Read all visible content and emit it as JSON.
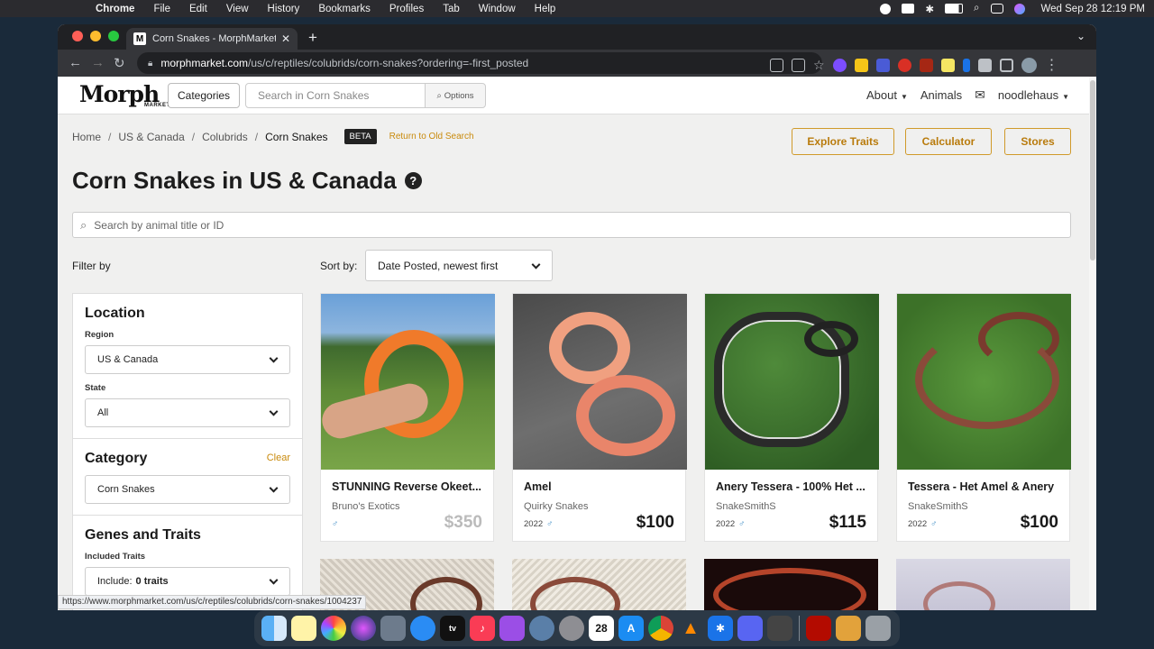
{
  "menubar": {
    "app": "Chrome",
    "items": [
      "File",
      "Edit",
      "View",
      "History",
      "Bookmarks",
      "Profiles",
      "Tab",
      "Window",
      "Help"
    ],
    "clock": "Wed Sep 28  12:19 PM"
  },
  "browser": {
    "tab_title": "Corn Snakes - MorphMarket U",
    "url_host": "morphmarket.com",
    "url_path": "/us/c/reptiles/colubrids/corn-snakes?ordering=-first_posted",
    "status_url": "https://www.morphmarket.com/us/c/reptiles/colubrids/corn-snakes/1004237"
  },
  "header": {
    "logo": "Morph",
    "logo_sub": "MARKET",
    "categories_label": "Categories",
    "search_placeholder": "Search in Corn Snakes",
    "options_label": "Options",
    "nav": {
      "about": "About",
      "animals": "Animals",
      "user": "noodlehaus"
    }
  },
  "breadcrumb": {
    "items": [
      "Home",
      "US & Canada",
      "Colubrids"
    ],
    "current": "Corn Snakes",
    "beta": "BETA",
    "old_search": "Return to Old Search"
  },
  "actions": {
    "explore": "Explore Traits",
    "calculator": "Calculator",
    "stores": "Stores"
  },
  "page_title": "Corn Snakes in US & Canada",
  "animal_search_placeholder": "Search by animal title or ID",
  "filter_by": "Filter by",
  "sort": {
    "label": "Sort by:",
    "value": "Date Posted, newest first"
  },
  "sidebar": {
    "location": {
      "title": "Location",
      "region_label": "Region",
      "region_value": "US & Canada",
      "state_label": "State",
      "state_value": "All"
    },
    "category": {
      "title": "Category",
      "clear": "Clear",
      "value": "Corn Snakes"
    },
    "genes": {
      "title": "Genes and Traits",
      "included_label": "Included Traits",
      "include_prefix": "Include:",
      "include_value": "0 traits"
    }
  },
  "listings": [
    {
      "name": "STUNNING Reverse Okeet...",
      "seller": "Bruno's Exotics",
      "year": "",
      "sex": "♂",
      "price": "$350"
    },
    {
      "name": "Amel",
      "seller": "Quirky Snakes",
      "year": "2022",
      "sex": "♂",
      "price": "$100"
    },
    {
      "name": "Anery Tessera - 100% Het ...",
      "seller": "SnakeSmithS",
      "year": "2022",
      "sex": "♂",
      "price": "$115"
    },
    {
      "name": "Tessera - Het Amel & Anery",
      "seller": "SnakeSmithS",
      "year": "2022",
      "sex": "♂",
      "price": "$100"
    }
  ],
  "colors": {
    "accent": "#c98a0c",
    "male": "#3a8ac4"
  }
}
